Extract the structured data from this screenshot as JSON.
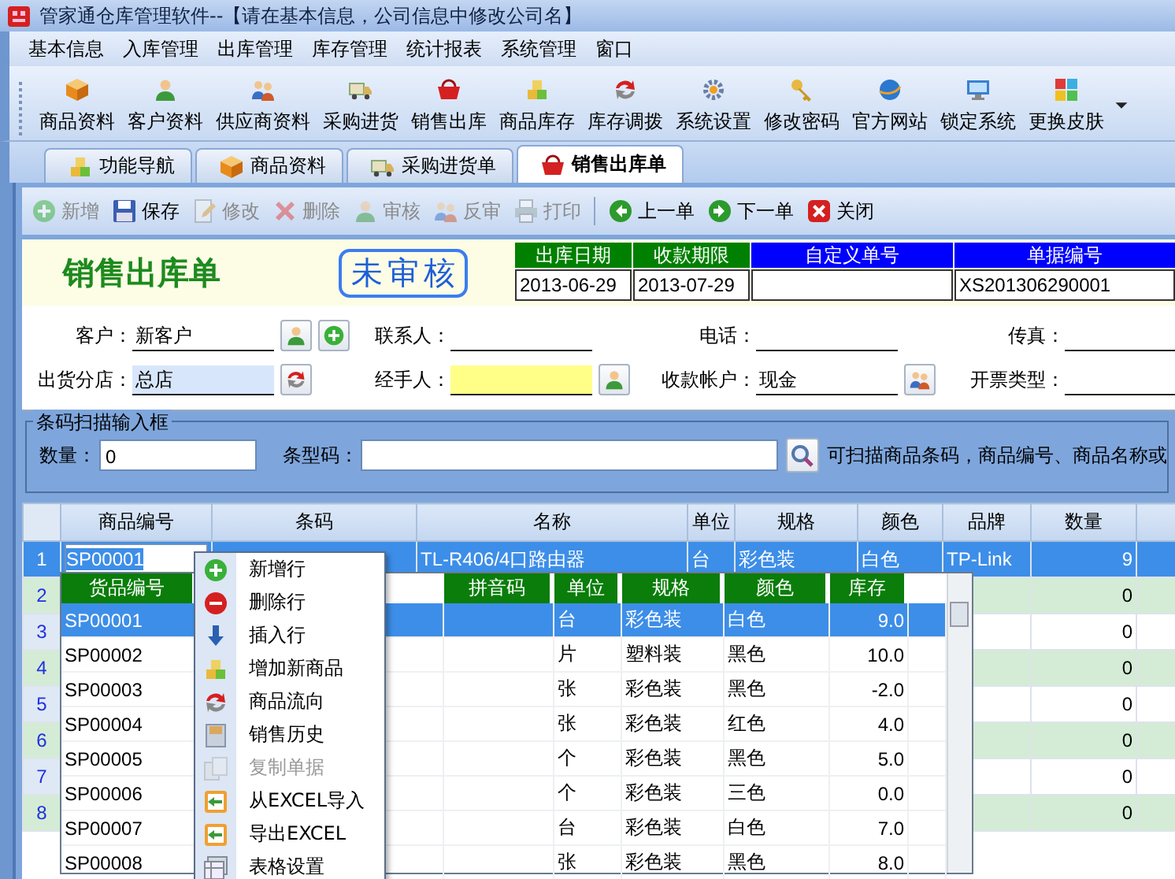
{
  "window": {
    "title": "管家通仓库管理软件--【请在基本信息，公司信息中修改公司名】"
  },
  "menu": [
    "基本信息",
    "入库管理",
    "出库管理",
    "库存管理",
    "统计报表",
    "系统管理",
    "窗口"
  ],
  "toolbar": [
    "商品资料",
    "客户资料",
    "供应商资料",
    "采购进货",
    "销售出库",
    "商品库存",
    "库存调拨",
    "系统设置",
    "修改密码",
    "官方网站",
    "锁定系统",
    "更换皮肤"
  ],
  "tabs": [
    {
      "label": "功能导航",
      "selected": false
    },
    {
      "label": "商品资料",
      "selected": false
    },
    {
      "label": "采购进货单",
      "selected": false
    },
    {
      "label": "销售出库单",
      "selected": true
    }
  ],
  "actions": [
    {
      "label": "新增",
      "disabled": true
    },
    {
      "label": "保存",
      "disabled": false
    },
    {
      "label": "修改",
      "disabled": true
    },
    {
      "label": "删除",
      "disabled": true
    },
    {
      "label": "审核",
      "disabled": true
    },
    {
      "label": "反审",
      "disabled": true
    },
    {
      "label": "打印",
      "disabled": true
    },
    {
      "label": "上一单",
      "disabled": false
    },
    {
      "label": "下一单",
      "disabled": false
    },
    {
      "label": "关闭",
      "disabled": false
    }
  ],
  "document": {
    "title": "销售出库单",
    "status": "未审核",
    "header_fields": [
      {
        "label": "出库日期",
        "value": "2013-06-29",
        "color": "#008000"
      },
      {
        "label": "收款期限",
        "value": "2013-07-29",
        "color": "#008000"
      },
      {
        "label": "自定义单号",
        "color": "#0000ff"
      },
      {
        "label": "单据编号",
        "value": "XS201306290001",
        "color": "#0000ff"
      }
    ]
  },
  "form": {
    "rows": [
      {
        "fields": [
          {
            "label": "客户：",
            "value": "新客户",
            "kind": "plain",
            "picker": true,
            "add": true
          },
          {
            "label": "联系人：",
            "kind": "plain"
          },
          {
            "label": "电话：",
            "kind": "plain"
          },
          {
            "label": "传真：",
            "kind": "plain"
          }
        ]
      },
      {
        "fields": [
          {
            "label": "出货分店：",
            "value": "总店",
            "kind": "focused",
            "picker": true
          },
          {
            "label": "经手人：",
            "kind": "highlighted",
            "picker": true
          },
          {
            "label": "收款帐户：",
            "value": "现金",
            "kind": "plain",
            "picker": true
          },
          {
            "label": "开票类型：",
            "kind": "plain"
          }
        ]
      }
    ]
  },
  "barcode": {
    "title": "条码扫描输入框",
    "quantity_label": "数量：",
    "quantity": "0",
    "code_label": "条型码：",
    "hint": "可扫描商品条码，商品编号、商品名称或"
  },
  "grid": {
    "columns": [
      "商品编号",
      "条码",
      "名称",
      "单位",
      "规格",
      "颜色",
      "品牌",
      "数量"
    ],
    "rows": [
      {
        "number": "1",
        "selected": true,
        "product_code": "SP00001",
        "name": "TL-R406/4口路由器",
        "unit": "台",
        "spec": "彩色装",
        "color_name": "白色",
        "brand": "TP-Link",
        "quantity": "9"
      },
      {
        "number": "2",
        "selected": false,
        "quantity": "0"
      },
      {
        "number": "3",
        "selected": false,
        "quantity": "0"
      },
      {
        "number": "4",
        "selected": false,
        "quantity": "0"
      },
      {
        "number": "5",
        "selected": false,
        "quantity": "0"
      },
      {
        "number": "6",
        "selected": false,
        "quantity": "0"
      },
      {
        "number": "7",
        "selected": false,
        "quantity": "0"
      },
      {
        "number": "8",
        "selected": false,
        "quantity": "0"
      }
    ]
  },
  "dropdown": {
    "columns": [
      "货品编号",
      "拼音码",
      "单位",
      "规格",
      "颜色",
      "库存"
    ],
    "rows": [
      {
        "code": "SP00001",
        "unit": "台",
        "spec": "彩色装",
        "color_name": "白色",
        "stock": "9.0",
        "selected": true
      },
      {
        "code": "SP00002",
        "unit": "片",
        "spec": "塑料装",
        "color_name": "黑色",
        "stock": "10.0",
        "selected": false
      },
      {
        "code": "SP00003",
        "unit": "张",
        "spec": "彩色装",
        "color_name": "黑色",
        "stock": "-2.0",
        "selected": false
      },
      {
        "code": "SP00004",
        "unit": "张",
        "spec": "彩色装",
        "color_name": "红色",
        "stock": "4.0",
        "selected": false
      },
      {
        "code": "SP00005",
        "unit": "个",
        "spec": "彩色装",
        "color_name": "黑色",
        "stock": "5.0",
        "selected": false
      },
      {
        "code": "SP00006",
        "unit": "个",
        "spec": "彩色装",
        "color_name": "三色",
        "stock": "0.0",
        "selected": false
      },
      {
        "code": "SP00007",
        "unit": "台",
        "spec": "彩色装",
        "color_name": "白色",
        "stock": "7.0",
        "selected": false
      },
      {
        "code": "SP00008",
        "unit": "张",
        "spec": "彩色装",
        "color_name": "黑色",
        "stock": "8.0",
        "selected": false
      }
    ]
  },
  "context_menu": [
    {
      "label": "新增行",
      "disabled": false
    },
    {
      "label": "删除行",
      "disabled": false
    },
    {
      "label": "插入行",
      "disabled": false
    },
    {
      "label": "增加新商品",
      "disabled": false
    },
    {
      "label": "商品流向",
      "disabled": false
    },
    {
      "label": "销售历史",
      "disabled": false
    },
    {
      "label": "复制单据",
      "disabled": true
    },
    {
      "label": "从EXCEL导入",
      "disabled": false
    },
    {
      "label": "导出EXCEL",
      "disabled": false
    },
    {
      "label": "表格设置",
      "disabled": false
    }
  ]
}
